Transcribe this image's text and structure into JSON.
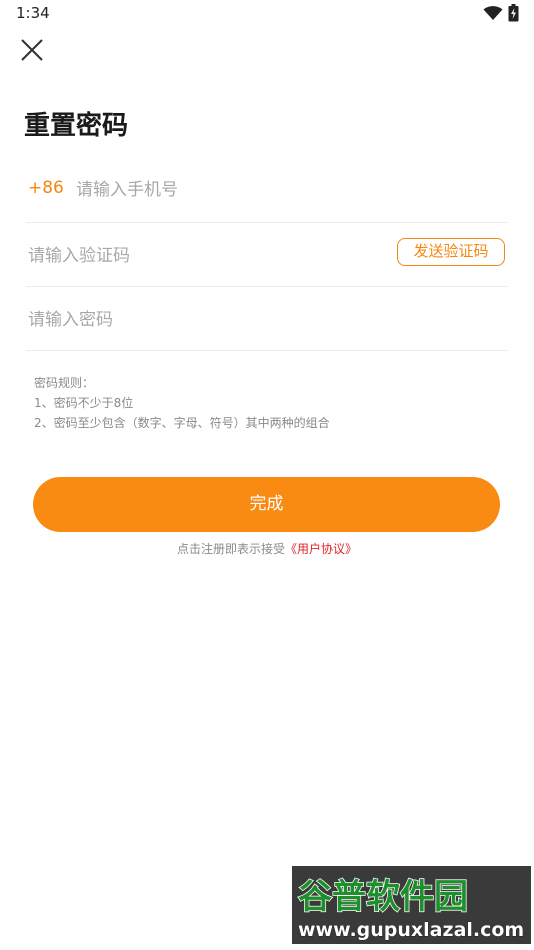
{
  "status_bar": {
    "time": "1:34",
    "icons": [
      "wifi-icon",
      "battery-charging-icon"
    ]
  },
  "colors": {
    "accent": "#f5870f",
    "button": "#f98a12",
    "link": "#e0242b",
    "hint": "#8a8a8a"
  },
  "header": {
    "close_icon": "close-icon",
    "title": "重置密码"
  },
  "form": {
    "country_code": "+86",
    "phone_placeholder": "请输入手机号",
    "code_placeholder": "请输入验证码",
    "send_code_label": "发送验证码",
    "password_placeholder": "请输入密码"
  },
  "rules": {
    "heading": "密码规则：",
    "items": [
      "1、密码不少于8位",
      "2、密码至少包含（数字、字母、符号）其中两种的组合"
    ]
  },
  "actions": {
    "done_label": "完成"
  },
  "agreement": {
    "prefix": "点击注册即表示接受",
    "link": "《用户协议》"
  },
  "watermark": {
    "logo_text": "谷普软件园",
    "url": "www.gupuxlazal.com"
  }
}
